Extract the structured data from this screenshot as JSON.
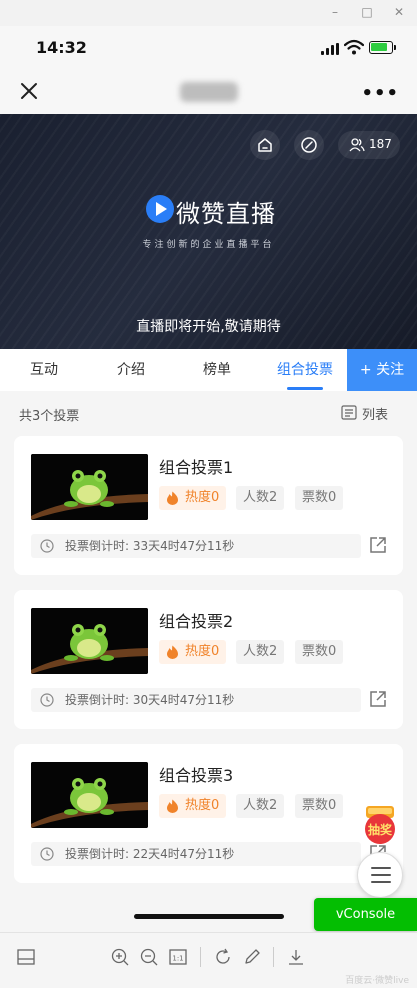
{
  "window": {
    "minimize_glyph": "–",
    "maximize_glyph": "□",
    "close_glyph": "✕"
  },
  "status_bar": {
    "time": "14:32"
  },
  "nav": {
    "more_glyph": "•••"
  },
  "banner": {
    "viewer_count": "187",
    "brand_name": "微赞直播",
    "slogan": "专注创新的企业直播平台",
    "coming_soon": "直播即将开始,敬请期待"
  },
  "tabs": [
    {
      "label": "互动",
      "active": false
    },
    {
      "label": "介绍",
      "active": false
    },
    {
      "label": "榜单",
      "active": false
    },
    {
      "label": "组合投票",
      "active": true
    }
  ],
  "follow_button": "+ 关注",
  "list": {
    "count_text": "共3个投票",
    "view_toggle": "列表"
  },
  "votes": [
    {
      "title": "组合投票1",
      "heat": "热度0",
      "people": "人数2",
      "tickets": "票数0",
      "countdown": "投票倒计时: 33天4时47分11秒"
    },
    {
      "title": "组合投票2",
      "heat": "热度0",
      "people": "人数2",
      "tickets": "票数0",
      "countdown": "投票倒计时: 30天4时47分11秒"
    },
    {
      "title": "组合投票3",
      "heat": "热度0",
      "people": "人数2",
      "tickets": "票数0",
      "countdown": "投票倒计时: 22天4时47分11秒"
    }
  ],
  "lottery_badge": "抽奖",
  "vconsole": "vConsole",
  "toolbar": {
    "zoom_ratio": "1:1"
  },
  "watermark": "百度云·微赞live",
  "colors": {
    "accent": "#2a7ef7",
    "follow": "#3d8ff9",
    "heat": "#f0832a",
    "vconsole": "#04be02"
  }
}
